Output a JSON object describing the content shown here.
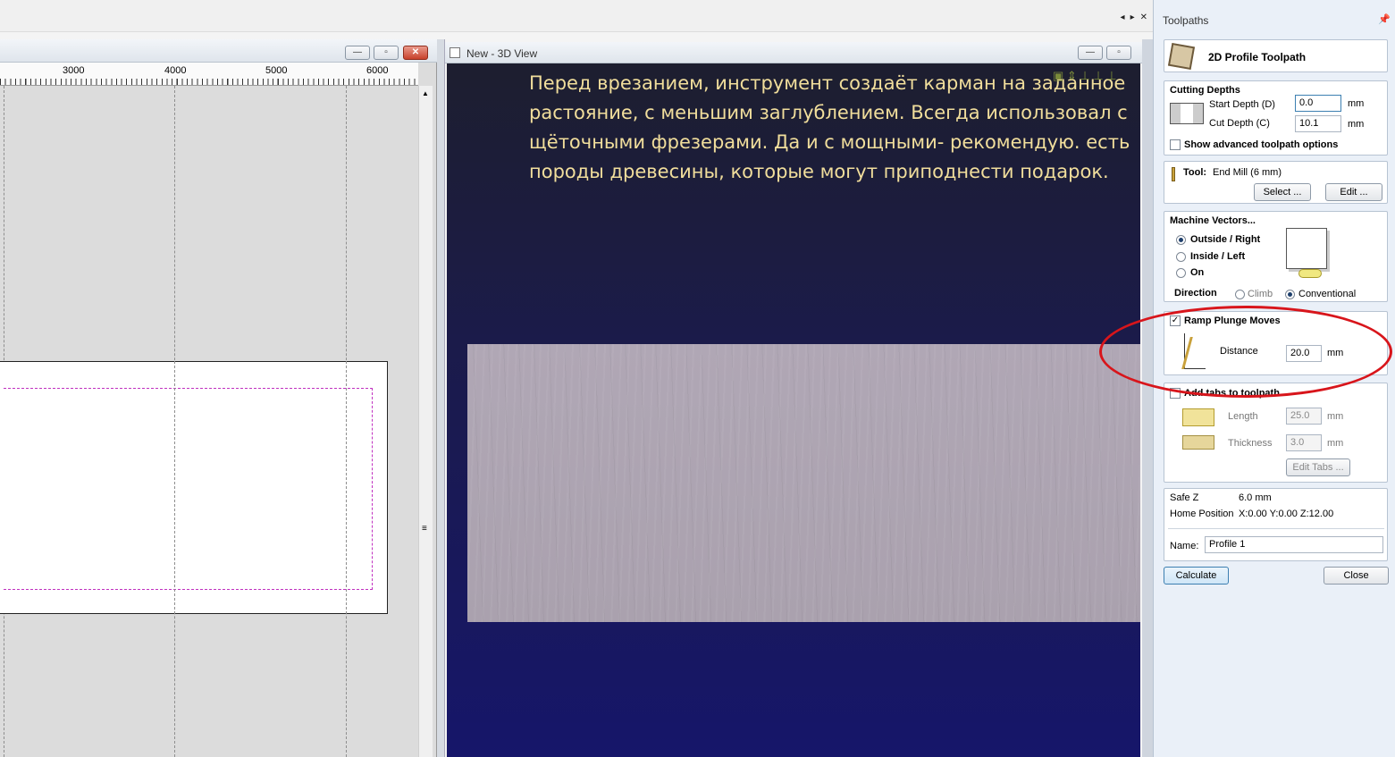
{
  "top_controls": [
    "◂",
    "▸",
    "✕"
  ],
  "window_2d": {
    "buttons": {
      "minimize": "—",
      "maximize": "▫",
      "close": "✕"
    },
    "ruler_labels": [
      "3000",
      "4000",
      "5000",
      "6000"
    ],
    "scroll_grip": "≡"
  },
  "window_3d": {
    "title": "New - 3D View",
    "buttons": {
      "minimize": "—",
      "maximize": "▫"
    },
    "caption": "Перед врезанием, инструмент создаёт карман на заданное растояние, с меньшим заглублением. Всегда использовал с щёточными фрезерами. Да и с мощными- рекомендую. есть породы древесины, которые могут приподнести подарок.",
    "view_icons_text": "▣ ⇕ ⊥ ⊥ ⊥"
  },
  "toolpaths": {
    "header": "Toolpaths",
    "pin_icon": "📌",
    "title": "2D Profile Toolpath",
    "cutting_depths": {
      "heading": "Cutting Depths",
      "start_label": "Start Depth (D)",
      "start_value": "0.0",
      "cut_label": "Cut Depth (C)",
      "cut_value": "10.1",
      "unit": "mm",
      "advanced_label": "Show advanced toolpath options"
    },
    "tool": {
      "label": "Tool:",
      "value": "End Mill (6 mm)",
      "select_button": "Select ...",
      "edit_button": "Edit ..."
    },
    "machine_vectors": {
      "heading": "Machine Vectors...",
      "options": [
        "Outside / Right",
        "Inside / Left",
        "On"
      ],
      "selected": "Outside / Right",
      "direction_label": "Direction",
      "direction_options": [
        "Climb",
        "Conventional"
      ],
      "direction_selected": "Conventional"
    },
    "ramp": {
      "label": "Ramp Plunge Moves",
      "checked": true,
      "distance_label": "Distance",
      "distance_value": "20.0",
      "unit": "mm"
    },
    "tabs": {
      "label": "Add tabs to toolpath",
      "checked": false,
      "length_label": "Length",
      "length_value": "25.0",
      "thickness_label": "Thickness",
      "thickness_value": "3.0",
      "unit": "mm",
      "edit_button": "Edit Tabs ..."
    },
    "safe": {
      "safe_z_label": "Safe Z",
      "safe_z_value": "6.0 mm",
      "home_label": "Home Position",
      "home_value": "X:0.00 Y:0.00 Z:12.00"
    },
    "name": {
      "label": "Name:",
      "value": "Profile 1"
    },
    "calculate_button": "Calculate",
    "close_button": "Close"
  },
  "colors": {
    "annotation": "#d8151b",
    "caption_text": "#f1de9c",
    "view_bg": "#1b1b4a",
    "offset_line": "#c030c0"
  }
}
